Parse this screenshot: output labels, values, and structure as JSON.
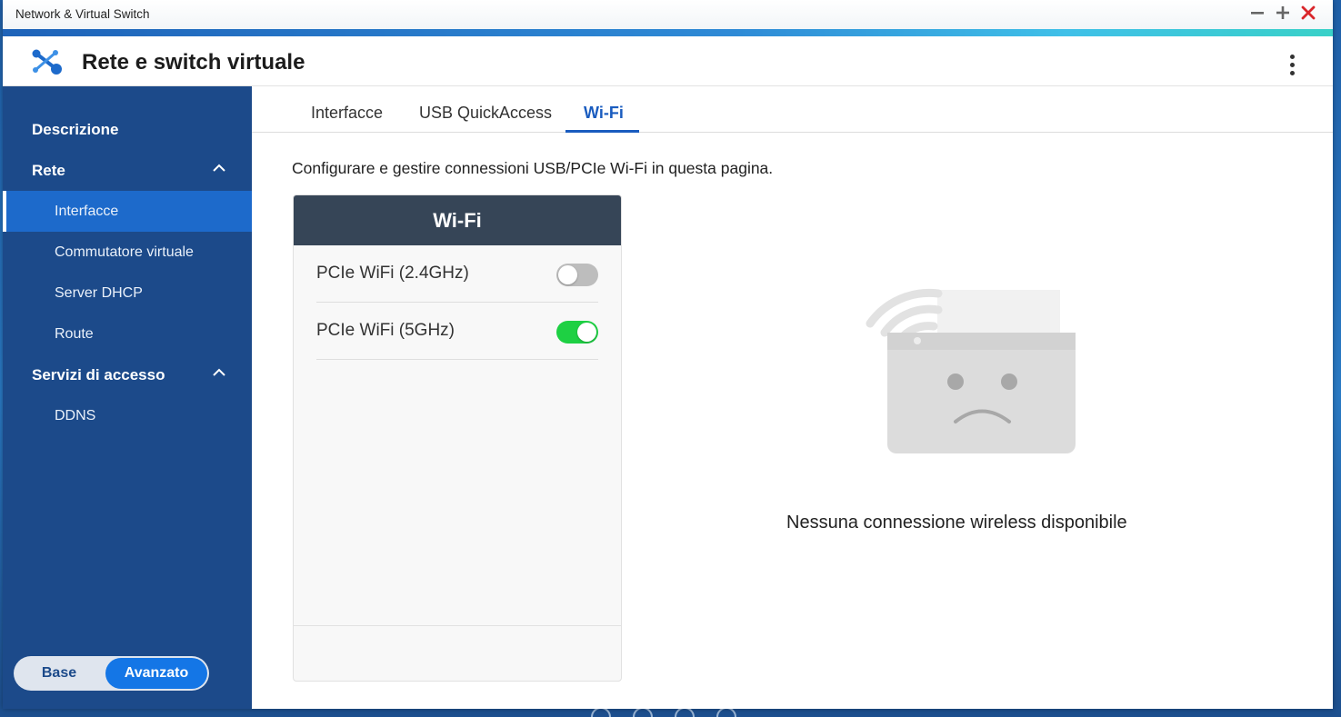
{
  "window": {
    "title": "Network & Virtual Switch",
    "controls": [
      "minimize-icon",
      "maximize-icon",
      "close-icon"
    ]
  },
  "app": {
    "title": "Rete e switch virtuale"
  },
  "sidebar": {
    "items": [
      {
        "label": "Descrizione",
        "type": "section"
      },
      {
        "label": "Rete",
        "type": "section",
        "expanded": true
      },
      {
        "label": "Interfacce",
        "type": "sub",
        "active": true
      },
      {
        "label": "Commutatore virtuale",
        "type": "sub"
      },
      {
        "label": "Server DHCP",
        "type": "sub"
      },
      {
        "label": "Route",
        "type": "sub"
      },
      {
        "label": "Servizi di accesso",
        "type": "section",
        "expanded": true
      },
      {
        "label": "DDNS",
        "type": "sub"
      }
    ],
    "mode": {
      "base_label": "Base",
      "advanced_label": "Avanzato",
      "selected": "Avanzato"
    }
  },
  "tabs": [
    {
      "label": "Interfacce"
    },
    {
      "label": "USB QuickAccess"
    },
    {
      "label": "Wi-Fi",
      "active": true
    }
  ],
  "main": {
    "description": "Configurare e gestire connessioni USB/PCIe Wi-Fi in questa pagina.",
    "wifi_card": {
      "title": "Wi-Fi",
      "adapters": [
        {
          "label": "PCIe WiFi (2.4GHz)",
          "enabled": false
        },
        {
          "label": "PCIe WiFi (5GHz)",
          "enabled": true
        }
      ]
    },
    "empty_message": "Nessuna connessione wireless disponibile"
  },
  "colors": {
    "sidebar_bg": "#1c4a8a",
    "active_item": "#1d6acb",
    "card_header": "#364557",
    "toggle_on": "#1ed043",
    "accent": "#1a5cbf"
  }
}
